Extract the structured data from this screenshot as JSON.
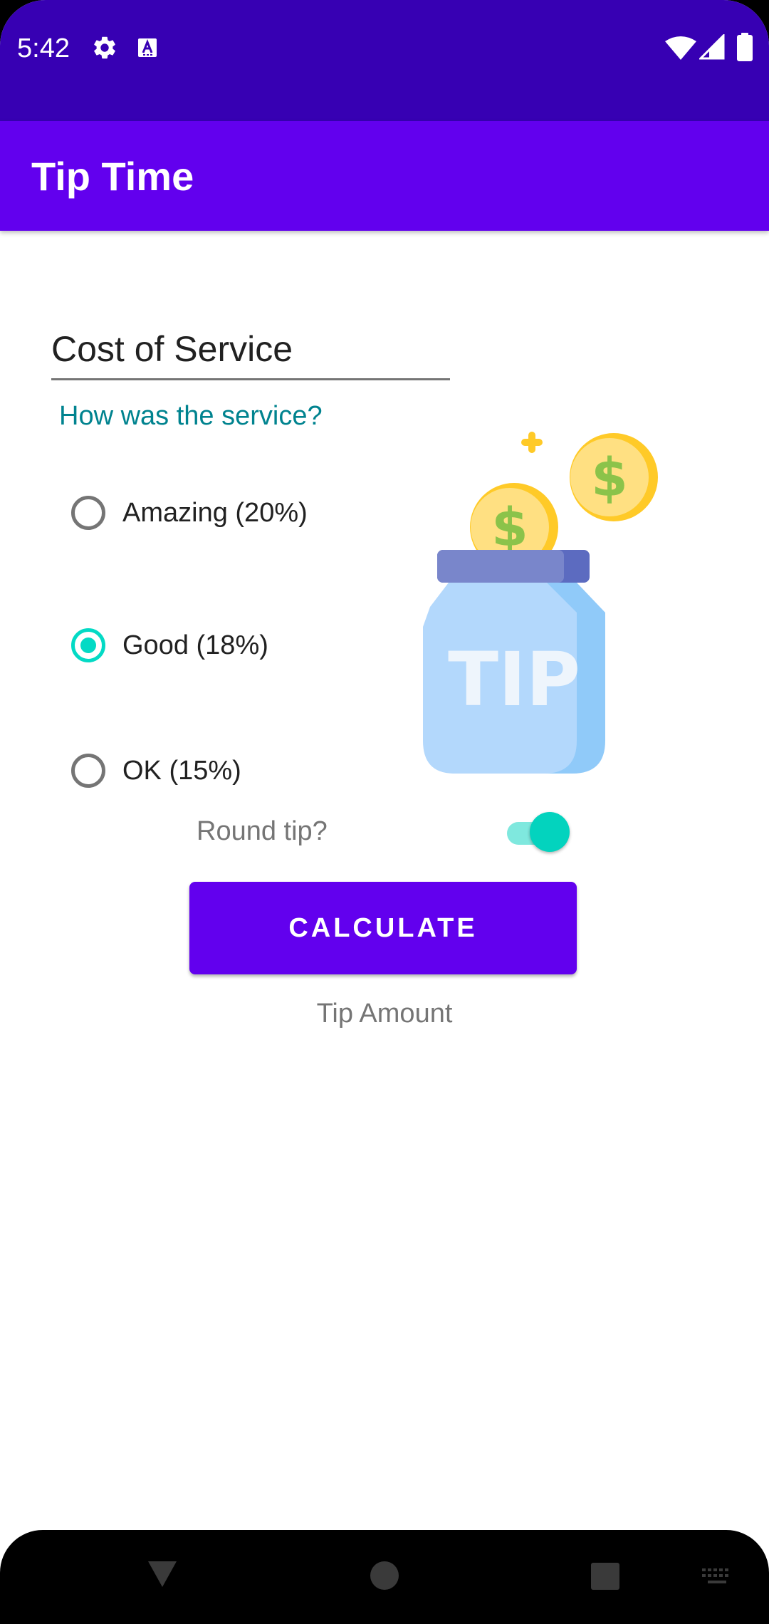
{
  "status_bar": {
    "time": "5:42",
    "icons_left": [
      "gear-icon",
      "keyboard-a-icon"
    ],
    "icons_right": [
      "wifi-icon",
      "cellular-signal-icon",
      "battery-icon"
    ]
  },
  "app_bar": {
    "title": "Tip Time"
  },
  "form": {
    "cost_placeholder": "Cost of Service",
    "cost_value": "",
    "question": "How was the service?",
    "options": [
      {
        "label": "Amazing (20%)",
        "checked": false
      },
      {
        "label": "Good (18%)",
        "checked": true
      },
      {
        "label": "OK (15%)",
        "checked": false
      }
    ],
    "round_tip_label": "Round tip?",
    "round_tip_on": true,
    "calculate_label": "CALCULATE",
    "tip_amount_label": "Tip Amount"
  },
  "illustration": {
    "jar_text": "TIP"
  },
  "nav_bar": {
    "icons": [
      "back-icon",
      "home-icon",
      "recents-icon",
      "keyboard-icon"
    ]
  },
  "colors": {
    "status_bar": "#3700b3",
    "primary": "#6200ee",
    "accent": "#03dac5",
    "question_text": "#00838f"
  }
}
